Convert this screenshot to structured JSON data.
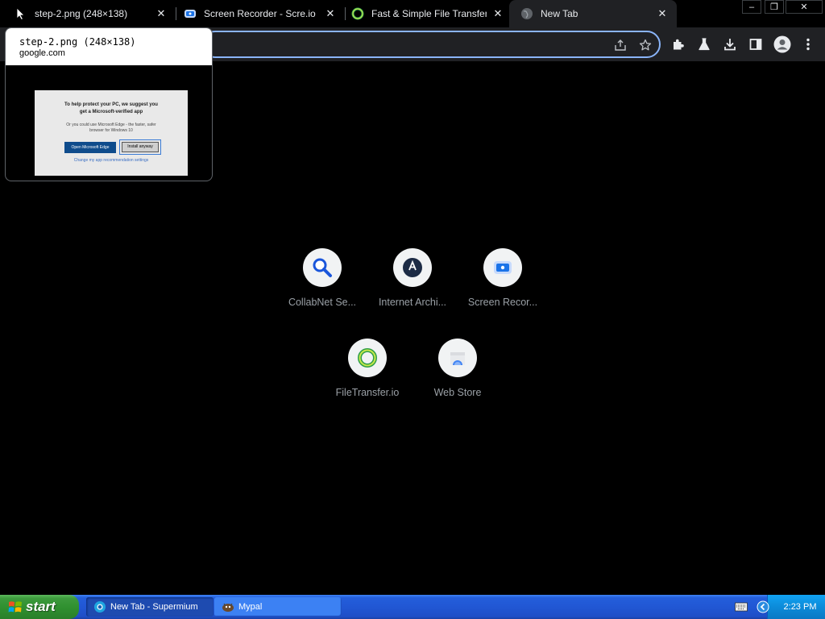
{
  "browser": {
    "tabs": [
      {
        "title": "step-2.png (248×138)",
        "favicon": "cursor-icon",
        "active": false
      },
      {
        "title": "Screen Recorder - Scre.io",
        "favicon": "screen-recorder-icon",
        "active": false
      },
      {
        "title": "Fast & Simple File Transfers -",
        "favicon": "filetransfer-icon",
        "active": false
      },
      {
        "title": "New Tab",
        "favicon": "globe-icon",
        "active": true
      }
    ],
    "window_controls": {
      "minimize": "–",
      "restore": "❐",
      "close": "✕"
    },
    "omnibox": {
      "value": ""
    },
    "toolbar_icons": [
      "share-icon",
      "bookmark-star-icon",
      "extensions-icon",
      "labs-icon",
      "download-icon",
      "side-panel-icon",
      "profile-icon",
      "menu-icon"
    ]
  },
  "hover_card": {
    "title": "step-2.png (248×138)",
    "domain": "google.com",
    "thumbnail": {
      "heading_line1": "To help protect your PC, we suggest you",
      "heading_line2": "get a Microsoft-verified app",
      "body_line1": "Or you could use Microsoft Edge - the faster, safer",
      "body_line2": "browser for Windows 10",
      "primary_button": "Open Microsoft Edge",
      "secondary_button": "Install anyway",
      "link": "Change my app recommendation settings"
    }
  },
  "shortcuts": [
    {
      "label": "CollabNet Se...",
      "icon": "search-magnifier-icon"
    },
    {
      "label": "Internet Archi...",
      "icon": "internet-archive-icon"
    },
    {
      "label": "Screen Recor...",
      "icon": "screen-recorder-icon"
    },
    {
      "label": "FileTransfer.io",
      "icon": "filetransfer-icon"
    },
    {
      "label": "Web Store",
      "icon": "web-store-icon"
    }
  ],
  "taskbar": {
    "start_label": "start",
    "tasks": [
      {
        "label": "New Tab - Supermium",
        "icon": "supermium-icon",
        "active": true
      },
      {
        "label": "Mypal",
        "icon": "mypal-icon",
        "active": false
      }
    ],
    "clock": "2:23 PM"
  },
  "colors": {
    "accent_blue": "#8ab4f8",
    "toolbar_bg": "#202124",
    "page_bg": "#000000",
    "taskbar_blue": "#245edb",
    "start_green": "#3c9a3c"
  }
}
